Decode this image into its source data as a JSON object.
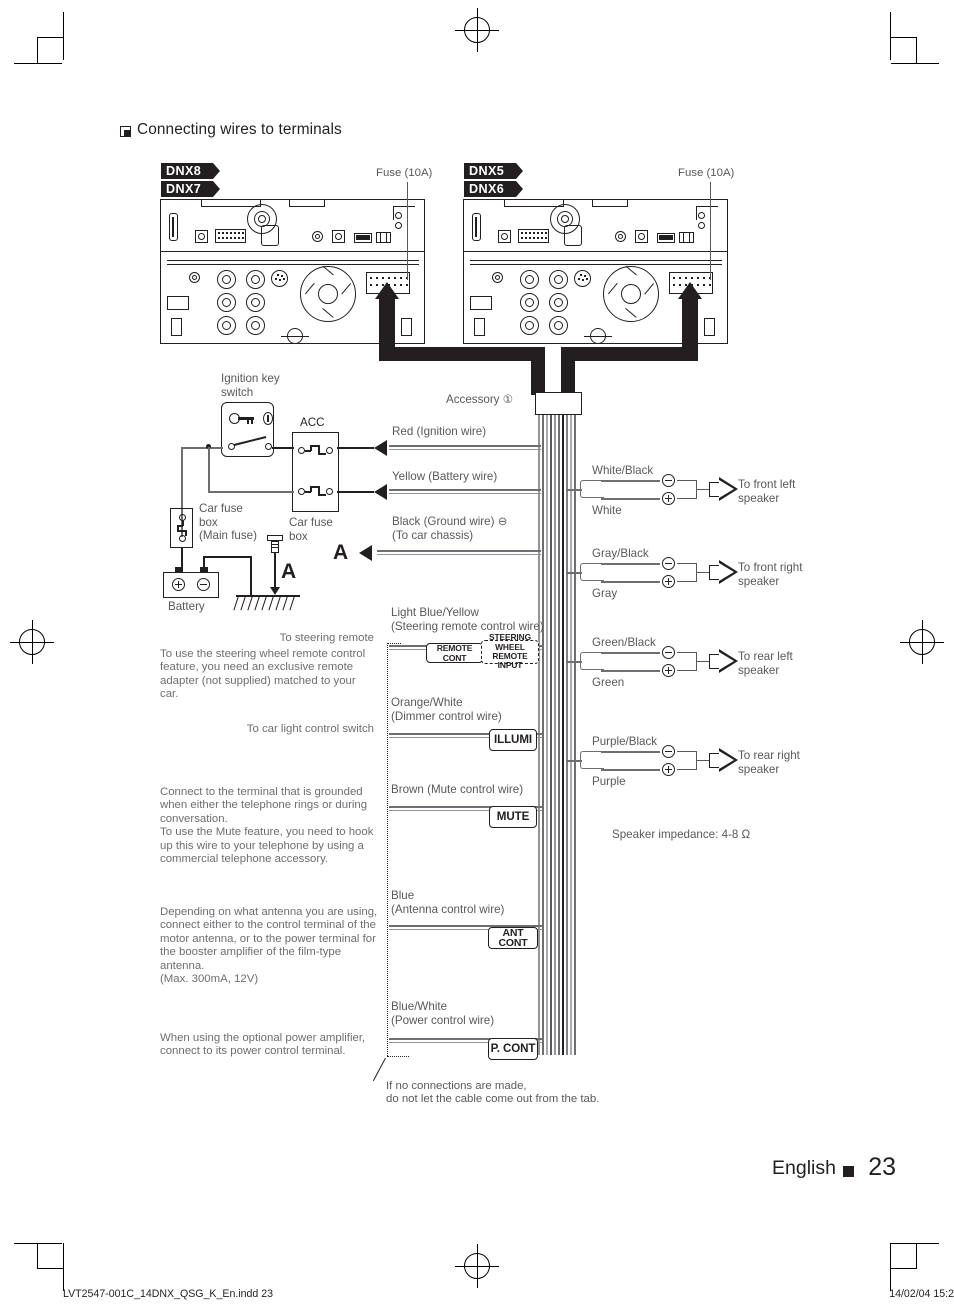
{
  "page": {
    "title": "Connecting wires to terminals",
    "language": "English",
    "number": "23",
    "footer_left": "LVT2547-001C_14DNX_QSG_K_En.indd   23",
    "footer_right": "14/02/04   15:2"
  },
  "units": [
    {
      "models": [
        "DNX8",
        "DNX7"
      ],
      "fuse_label": "Fuse (10A)"
    },
    {
      "models": [
        "DNX5",
        "DNX6"
      ],
      "fuse_label": "Fuse (10A)"
    }
  ],
  "harness": {
    "accessory_label": "Accessory ①",
    "ignition_switch_label": "Ignition key\nswitch",
    "acc_label": "ACC",
    "main_fuse_box_label": "Car fuse\nbox\n(Main fuse)",
    "fuse_box_label": "Car fuse\nbox",
    "battery_label": "Battery",
    "ground_marker": "A"
  },
  "power_wires": [
    {
      "name": "Red (Ignition wire)"
    },
    {
      "name": "Yellow (Battery wire)"
    },
    {
      "name": "Black (Ground wire)",
      "polarity": "⊖",
      "sub": "(To car chassis)"
    }
  ],
  "control_wires": [
    {
      "color": "Light Blue/Yellow",
      "desc": "(Steering remote control wire)",
      "box": "REMOTE CONT",
      "box2": "STEERING WHEEL REMOTE INPUT",
      "heading": "To steering remote",
      "note": "To use the steering wheel remote control feature, you need an exclusive remote adapter (not supplied) matched to your car."
    },
    {
      "color": "Orange/White",
      "desc": "(Dimmer control wire)",
      "box": "ILLUMI",
      "heading": "To car light control switch",
      "note": ""
    },
    {
      "color": "Brown (Mute control wire)",
      "desc": "",
      "box": "MUTE",
      "heading": "",
      "note": "Connect to the terminal that is grounded when either the telephone rings or during conversation.\nTo use the Mute feature, you need to hook up this wire to your telephone by using a commercial telephone accessory."
    },
    {
      "color": "Blue",
      "desc": "(Antenna control wire)",
      "box": "ANT CONT",
      "heading": "",
      "note": "Depending on what antenna you are using, connect either to the control terminal of the motor antenna, or to the power terminal for the booster amplifier of the film-type antenna.\n(Max. 300mA, 12V)"
    },
    {
      "color": "Blue/White",
      "desc": "(Power control wire)",
      "box": "P. CONT",
      "heading": "",
      "note": "When using the optional power amplifier, connect to its power control terminal."
    }
  ],
  "tab_note": "If no connections are made,\ndo not let the cable come out from the tab.",
  "speakers": [
    {
      "minus_wire": "White/Black",
      "plus_wire": "White",
      "target": "To front left\nspeaker"
    },
    {
      "minus_wire": "Gray/Black",
      "plus_wire": "Gray",
      "target": "To front right\nspeaker"
    },
    {
      "minus_wire": "Green/Black",
      "plus_wire": "Green",
      "target": "To rear left\nspeaker"
    },
    {
      "minus_wire": "Purple/Black",
      "plus_wire": "Purple",
      "target": "To rear right\nspeaker"
    }
  ],
  "impedance_note": "Speaker impedance: 4-8 Ω"
}
